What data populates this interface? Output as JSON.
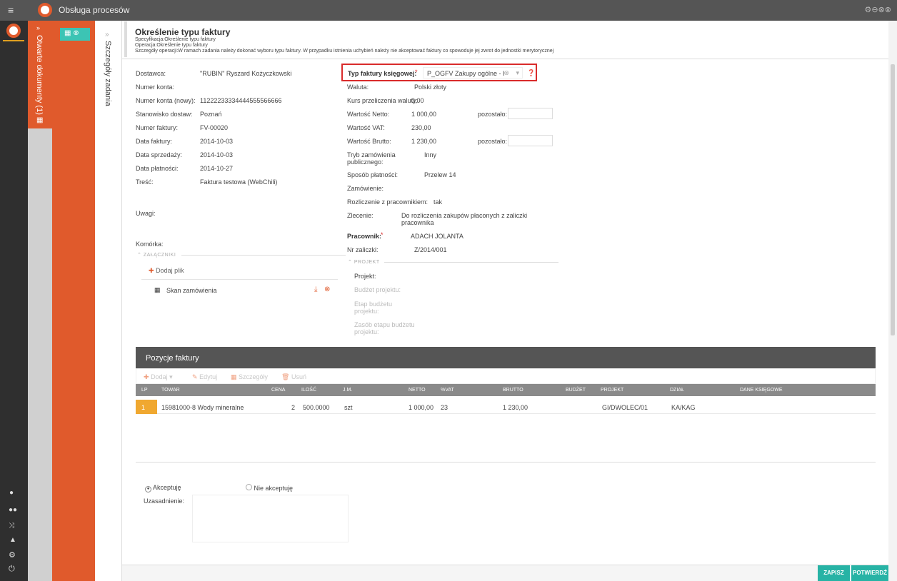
{
  "app": {
    "title": "Obsługa procesów"
  },
  "sidebar": {
    "open_docs": "Otwarte dokumenty (1)",
    "task_details": "Szczegóły zadania"
  },
  "header": {
    "title": "Określenie typu faktury",
    "spec": "Specyfikacja:Określenie typu faktury",
    "operation": "Operacja:Określenie typu faktury",
    "details": "Szczegóły operacji:W ramach zadania należy dokonać wyboru typu faktury. W przypadku istnienia uchybień należy nie akceptować faktury co spowoduje jej zwrot do jednostki merytorycznej"
  },
  "left_fields": [
    {
      "label": "Dostawca:",
      "value": "\"RUBIN\" Ryszard Kożyczkowski"
    },
    {
      "label": "Numer konta:",
      "value": ""
    },
    {
      "label": "Numer konta (nowy):",
      "value": "11222233334444555566666"
    },
    {
      "label": "Stanowisko dostaw:",
      "value": "Poznań"
    },
    {
      "label": "Numer faktury:",
      "value": "FV-00020"
    },
    {
      "label": "Data faktury:",
      "value": "2014-10-03"
    },
    {
      "label": "Data sprzedaży:",
      "value": "2014-10-03"
    },
    {
      "label": "Data płatności:",
      "value": "2014-10-27"
    },
    {
      "label": "Treść:",
      "value": "Faktura testowa (WebChili)"
    }
  ],
  "uwagi_label": "Uwagi:",
  "komorka_label": "Komórka:",
  "attachments": {
    "section": "ZAŁĄCZNIKI",
    "add": "Dodaj plik",
    "file": "Skan zamówienia"
  },
  "invoice_type": {
    "label": "Typ faktury księgowej:",
    "value": "P_OGFV Zakupy ogólne - I"
  },
  "right_fields": [
    {
      "label": "Waluta:",
      "value": "Polski złoty"
    },
    {
      "label": "Kurs przeliczenia waluty:",
      "value": "0,00"
    },
    {
      "label": "Wartość Netto:",
      "value": "1 000,00",
      "extra": "pozostało:"
    },
    {
      "label": "Wartość VAT:",
      "value": "230,00"
    },
    {
      "label": "Wartość Brutto:",
      "value": "1 230,00",
      "extra": "pozostało:"
    },
    {
      "label": "Tryb zamówienia publicznego:",
      "value": "Inny"
    },
    {
      "label": "Sposób płatności:",
      "value": "Przelew 14"
    },
    {
      "label": "Zamówienie:",
      "value": ""
    },
    {
      "label": "Rozliczenie z pracownikiem:",
      "value": "tak"
    },
    {
      "label": "Zlecenie:",
      "value": "Do rozliczenia zakupów płaconych z zaliczki pracownika"
    },
    {
      "label": "Pracownik:",
      "value": "ADACH JOLANTA"
    },
    {
      "label": "Nr zaliczki:",
      "value": "Z/2014/001"
    }
  ],
  "project": {
    "section": "PROJEKT",
    "fields": [
      "Projekt:",
      "Budżet projektu:",
      "Etap budżetu projektu:",
      "Zasób etapu budżetu projektu:"
    ]
  },
  "positions": {
    "title": "Pozycje faktury",
    "toolbar": [
      "Dodaj",
      "Edytuj",
      "Szczegóły",
      "Usuń"
    ],
    "columns": [
      "LP",
      "TOWAR",
      "CENA",
      "ILOŚĆ",
      "J.M.",
      "NETTO",
      "%VAT",
      "BRUTTO",
      "BUDŻET",
      "PROJEKT",
      "DZIAŁ",
      "DANE KSIĘGOWE"
    ],
    "rows": [
      [
        "1",
        "15981000-8 Wody mineralne",
        "2",
        "500.0000",
        "szt",
        "1 000,00",
        "23",
        "1 230,00",
        "",
        "GI/DWOLEC/01",
        "KA/KAG",
        ""
      ]
    ]
  },
  "decision": {
    "accept": "Akceptuję",
    "reject": "Nie akceptuję",
    "reason": "Uzasadnienie:"
  },
  "buttons": {
    "save": "ZAPISZ",
    "confirm": "POTWIERDŹ"
  },
  "colors": {
    "accent": "#e05a2c",
    "teal": "#3cc4b4",
    "highlight": "#d92b2b",
    "save": "#27b3a5"
  }
}
